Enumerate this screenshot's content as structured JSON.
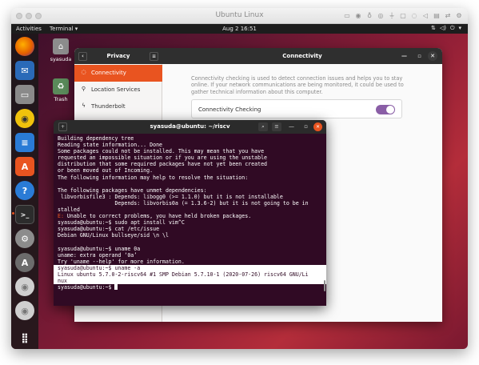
{
  "host_window": {
    "title": "Ubuntu Linux",
    "toolbar_icons": [
      "monitor-icon",
      "record-icon",
      "mic-icon",
      "camera-icon",
      "usb-icon",
      "folder-icon",
      "disc-icon",
      "speaker-icon",
      "printer-icon",
      "network-icon",
      "settings-icon"
    ]
  },
  "topbar": {
    "activities": "Activities",
    "app_menu": "Terminal ▾",
    "clock": "Aug 2  16:51",
    "tray": [
      "network-icon",
      "volume-icon",
      "power-icon",
      "menu-arrow-icon"
    ]
  },
  "dock": {
    "items": [
      {
        "name": "firefox",
        "icon": "firefox-icon",
        "color": "#e66000"
      },
      {
        "name": "thunderbird",
        "icon": "thunderbird-icon",
        "color": "#2a6ab8"
      },
      {
        "name": "files",
        "icon": "files-icon",
        "color": "#7a7a7a"
      },
      {
        "name": "rhythmbox",
        "icon": "rhythmbox-icon",
        "color": "#f0c20c"
      },
      {
        "name": "libreoffice-writer",
        "icon": "writer-icon",
        "color": "#2a7bd6"
      },
      {
        "name": "software",
        "icon": "software-icon",
        "color": "#e95420"
      },
      {
        "name": "help",
        "icon": "help-icon",
        "color": "#2a7bd6"
      },
      {
        "name": "terminal",
        "icon": "terminal-icon",
        "color": "#2c2c2c"
      },
      {
        "name": "settings",
        "icon": "settings-icon",
        "color": "#8c8c8c"
      },
      {
        "name": "software-updater",
        "icon": "updater-icon",
        "color": "#8c8c8c"
      },
      {
        "name": "dvd",
        "icon": "disc-icon",
        "color": "#bdbdbd"
      },
      {
        "name": "dvd2",
        "icon": "disc-icon",
        "color": "#bdbdbd"
      },
      {
        "name": "app-grid",
        "icon": "grid-icon",
        "color": "#3a3a3a"
      }
    ]
  },
  "desktop": {
    "icons": [
      {
        "label": "syasuda",
        "icon": "home-folder-icon"
      },
      {
        "label": "Trash",
        "icon": "trash-icon"
      }
    ]
  },
  "settings": {
    "sidebar_title": "Privacy",
    "sidebar_items": [
      {
        "label": "Connectivity",
        "icon": "network-icon",
        "active": true
      },
      {
        "label": "Location Services",
        "icon": "location-icon",
        "active": false
      },
      {
        "label": "Thunderbolt",
        "icon": "thunderbolt-icon",
        "active": false
      }
    ],
    "main_title": "Connectivity",
    "description": "Connectivity checking is used to detect connection issues and helps you to stay online. If your network communications are being monitored, it could be used to gather technical information about this computer.",
    "checking_label": "Connectivity Checking",
    "checking_enabled": true
  },
  "terminal": {
    "title": "syasuda@ubuntu: ~/riscv",
    "lines": [
      {
        "text": "Building dependency tree"
      },
      {
        "text": "Reading state information... Done"
      },
      {
        "text": "Some packages could not be installed. This may mean that you have"
      },
      {
        "text": "requested an impossible situation or if you are using the unstable"
      },
      {
        "text": "distribution that some required packages have not yet been created"
      },
      {
        "text": "or been moved out of Incoming."
      },
      {
        "text": "The following information may help to resolve the situation:"
      },
      {
        "text": ""
      },
      {
        "text": "The following packages have unmet dependencies:"
      },
      {
        "text": " libvorbisfile3 : Depends: libogg0 (>= 1.1.0) but it is not installable"
      },
      {
        "text": "                  Depends: libvorbis0a (= 1.3.6-2) but it is not going to be in"
      },
      {
        "text": "stalled"
      },
      {
        "text": "E: Unable to correct problems, you have held broken packages.",
        "prefix": "E:"
      },
      {
        "text": "syasuda@ubuntu:~$ sudo apt install vim^C"
      },
      {
        "text": "syasuda@ubuntu:~$ cat /etc/issue"
      },
      {
        "text": "Debian GNU/Linux bullseye/sid \\n \\l"
      },
      {
        "text": ""
      },
      {
        "text": "syasuda@ubuntu:~$ uname 0a"
      },
      {
        "text": "uname: extra operand ‘0a’"
      },
      {
        "text": "Try 'uname --help' for more information."
      },
      {
        "text": "syasuda@ubuntu:~$ uname -a",
        "highlight": true
      },
      {
        "text": "Linux ubuntu 5.7.0-2-riscv64 #1 SMP Debian 5.7.10-1 (2020-07-26) riscv64 GNU/Li",
        "highlight": true
      },
      {
        "text": "nux",
        "highlight": true
      },
      {
        "text": "syasuda@ubuntu:~$ ",
        "cursor": true
      }
    ]
  }
}
